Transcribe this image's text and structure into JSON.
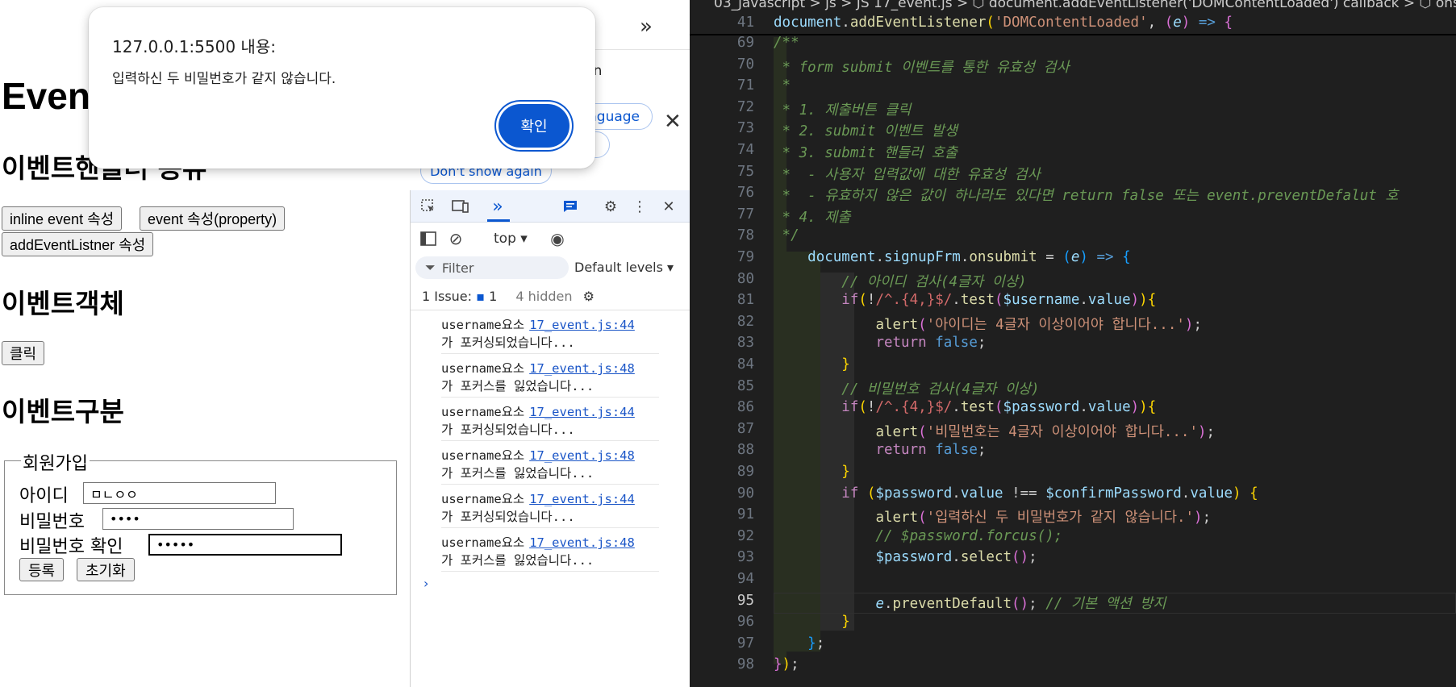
{
  "browser": {
    "page": {
      "heading": "Even",
      "section_handler": "이벤트핸들러 종류",
      "buttons": [
        "inline event 속성",
        "event 속성(property)",
        "addEventListner 속성"
      ],
      "section_event_object": "이벤트객체",
      "click_button": "클릭",
      "section_event_kind": "이벤트구분",
      "form": {
        "legend": "회원가입",
        "username_label": "아이디",
        "username_value": "ㅁㄴㅇㅇ",
        "password_label": "비밀번호",
        "password_value": "••••",
        "confirm_label": "비밀번호 확인",
        "confirm_value": "•••••",
        "submit_label": "등록",
        "reset_label": "초기화"
      }
    },
    "infobar": {
      "text": "e in",
      "language_button": "nguage",
      "dont_show": "Don't show again"
    },
    "dialog": {
      "title": "127.0.0.1:5500 내용:",
      "message": "입력하신 두 비밀번호가 같지 않습니다.",
      "ok_label": "확인"
    },
    "devtools": {
      "context": "top",
      "filter_placeholder": "Filter",
      "levels": "Default levels",
      "issues_label": "1 Issue:",
      "issues_count": "1",
      "hidden": "4 hidden",
      "logs": [
        {
          "msg1": "username요소",
          "src": "17_event.js:44",
          "msg2": "가 포커싱되었습니다..."
        },
        {
          "msg1": "username요소",
          "src": "17_event.js:48",
          "msg2": "가 포커스를 잃었습니다..."
        },
        {
          "msg1": "username요소",
          "src": "17_event.js:44",
          "msg2": "가 포커싱되었습니다..."
        },
        {
          "msg1": "username요소",
          "src": "17_event.js:48",
          "msg2": "가 포커스를 잃었습니다..."
        },
        {
          "msg1": "username요소",
          "src": "17_event.js:44",
          "msg2": "가 포커싱되었습니다..."
        },
        {
          "msg1": "username요소",
          "src": "17_event.js:48",
          "msg2": "가 포커스를 잃었습니다..."
        }
      ]
    }
  },
  "editor": {
    "breadcrumb": "03_javascript > js > JS 17_event.js > ⬡ document.addEventListener('DOMContentLoaded') callback > ⬡ onsubmit",
    "active_line": "95"
  }
}
